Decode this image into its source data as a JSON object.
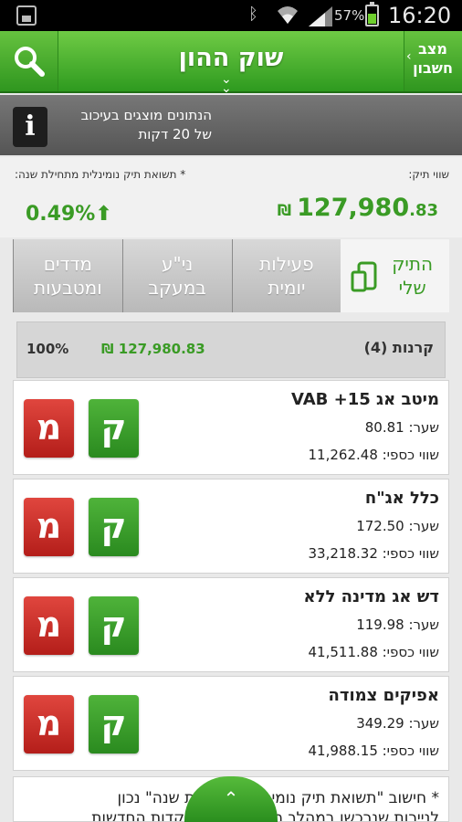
{
  "status_bar": {
    "battery": "57%",
    "time": "16:20"
  },
  "header": {
    "title": "שוק ההון",
    "account_line1": "מצב",
    "account_line2": "חשבון"
  },
  "info": {
    "line1": "הנתונים מוצגים בעיכוב",
    "line2": "של 20 דקות"
  },
  "summary": {
    "portfolio_label": "שווי תיק:",
    "return_label": "* תשואת תיק נומינלית מתחילת שנה:",
    "portfolio_value_main": "127,980",
    "portfolio_value_cents": ".83",
    "currency": "₪",
    "return_value": "0.49%"
  },
  "tabs": [
    {
      "line1": "התיק",
      "line2": "שלי"
    },
    {
      "line1": "פעילות",
      "line2": "יומית"
    },
    {
      "line1": "ני\"ע",
      "line2": "במעקב"
    },
    {
      "line1": "מדדים",
      "line2": "ומטבעות"
    }
  ],
  "group": {
    "name": "קרנות (4)",
    "value": "₪ 127,980.83",
    "percent": "100%"
  },
  "buttons": {
    "buy": "ק",
    "sell": "מ"
  },
  "funds": [
    {
      "name": "מיטב אג 15+ VAB",
      "price": "שער: 80.81",
      "value": "שווי כספי: 11,262.48"
    },
    {
      "name": "כלל אג\"ח",
      "price": "שער: 172.50",
      "value": "שווי כספי: 33,218.32"
    },
    {
      "name": "דש אג מדינה ללא",
      "price": "שער: 119.98",
      "value": "שווי כספי: 41,511.88"
    },
    {
      "name": "אפיקים צמודה",
      "price": "שער: 349.29",
      "value": "שווי כספי: 41,988.15"
    }
  ],
  "footnote": {
    "line1": "* חישוב \"תשואת תיק נומינלית מתחילת שנה\" נכון",
    "line2": "לניירות שנרכשו במהלך השנה ועד להפקדות החדשות"
  },
  "colors": {
    "accent_green": "#3a9b25",
    "sell_red": "#c52a24",
    "buy_green": "#3b9e2b"
  },
  "icons": [
    "search-icon",
    "info-icon",
    "portfolio-icon",
    "chevron-down-icon",
    "chevron-up-icon",
    "chevron-left-icon",
    "arrow-up-icon"
  ]
}
